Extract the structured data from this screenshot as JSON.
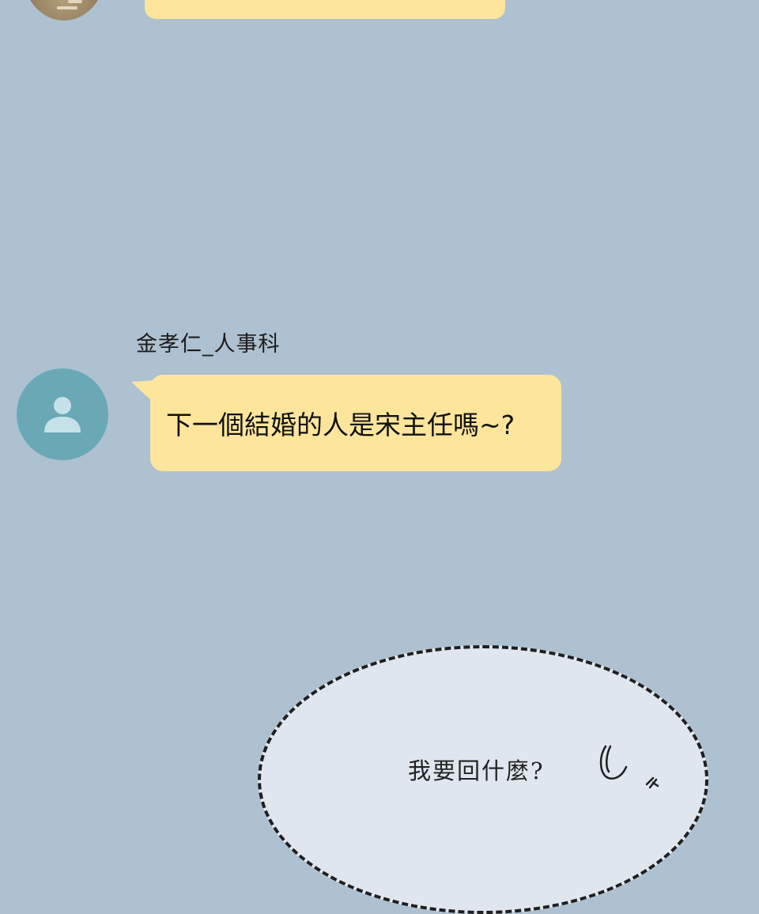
{
  "messages": [
    {
      "sender": "金孝仁_人事科",
      "avatar_icon": "person-icon",
      "text": "下一個結婚的人是宋主任嗎~?"
    }
  ],
  "thought": {
    "text": "我要回什麼?"
  },
  "colors": {
    "background": "#adc1d0",
    "bubble": "#fde59c",
    "avatar": "#6aa8b6",
    "thought_bubble": "#dfe6ee"
  }
}
